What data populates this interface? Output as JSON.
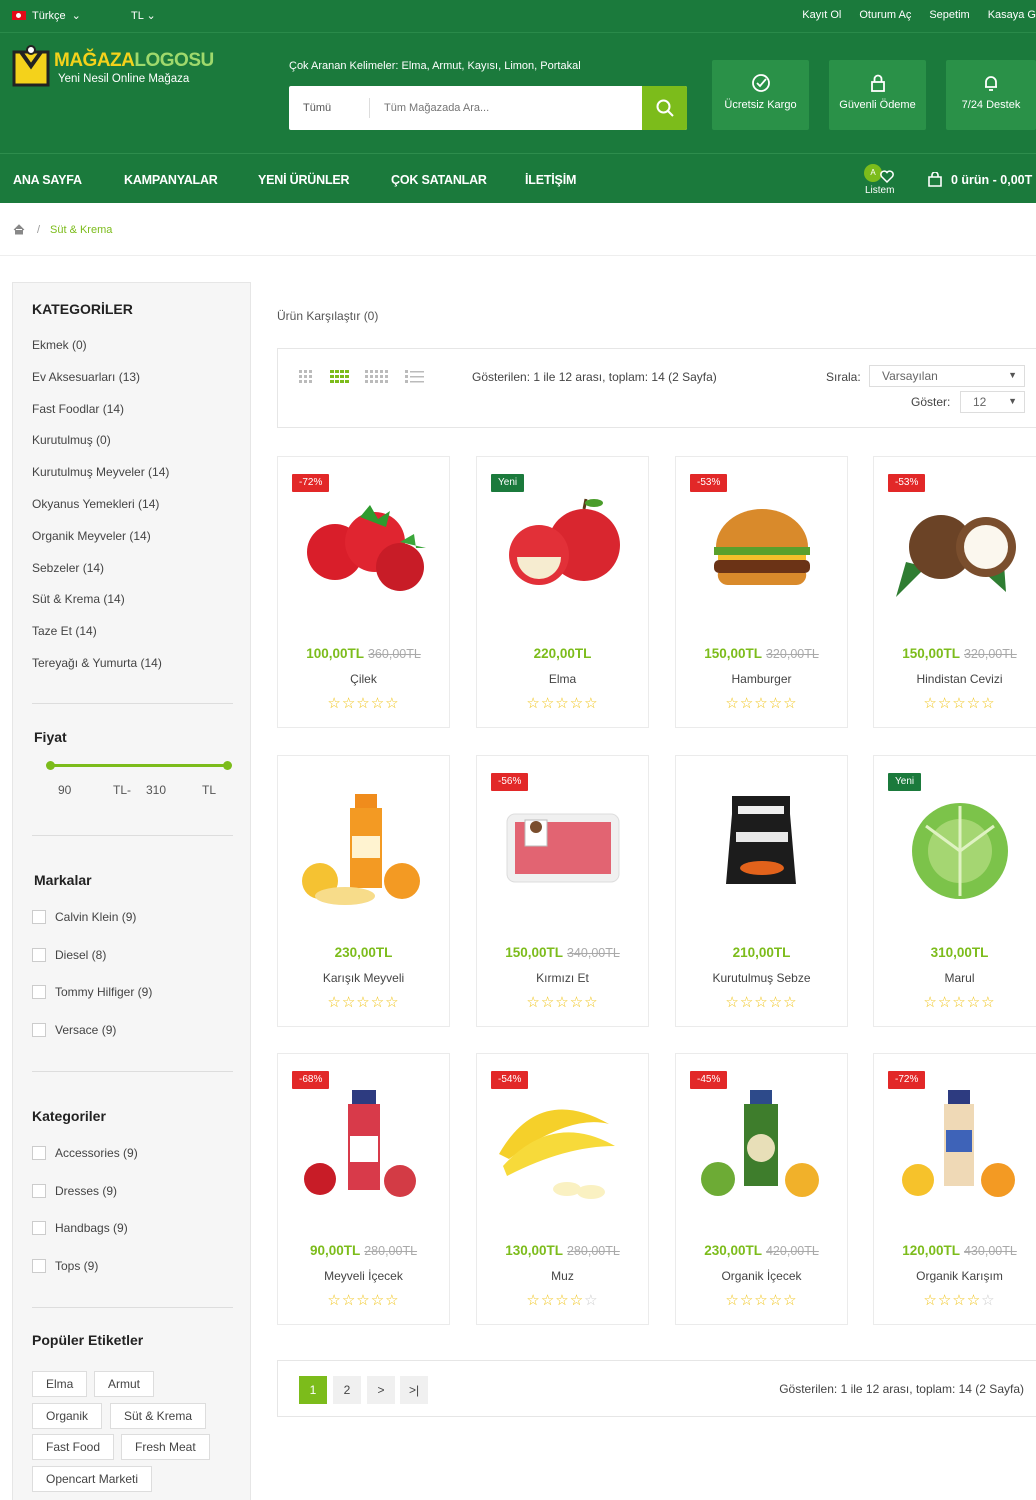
{
  "topbar": {
    "language": "Türkçe",
    "currency": "TL",
    "links": [
      "Kayıt Ol",
      "Oturum Aç",
      "Sepetim",
      "Kasaya G"
    ]
  },
  "logo": {
    "title_a": "MAĞAZA",
    "title_b": "LOGOSU",
    "tagline": "Yeni Nesil Online Mağaza"
  },
  "search": {
    "popular_label": "Çok Aranan Kelimeler:",
    "popular_words": "Elma, Armut, Kayısı, Limon, Portakal",
    "category": "Tümü",
    "placeholder": "Tüm Mağazada Ara..."
  },
  "features": [
    "Ücretsiz Kargo",
    "Güvenli Ödeme",
    "7/24 Destek"
  ],
  "nav": [
    "ANA SAYFA",
    "KAMPANYALAR",
    "YENİ ÜRÜNLER",
    "ÇOK SATANLAR",
    "İLETİŞİM"
  ],
  "wishlist": {
    "badge": "A",
    "label": "Listem"
  },
  "cart": {
    "label": "0 ürün - 0,00T"
  },
  "breadcrumb": {
    "current": "Süt & Krema"
  },
  "sidebar": {
    "categories_title": "KATEGORİLER",
    "categories": [
      "Ekmek (0)",
      "Ev Aksesuarları (13)",
      "Fast Foodlar (14)",
      "Kurutulmuş (0)",
      "Kurutulmuş Meyveler (14)",
      "Okyanus Yemekleri (14)",
      "Organik Meyveler (14)",
      "Sebzeler (14)",
      "Süt & Krema (14)",
      "Taze Et (14)",
      "Tereyağı & Yumurta (14)"
    ],
    "price_title": "Fiyat",
    "price_min": "90",
    "price_unit1": "TL-",
    "price_max": "310",
    "price_unit2": "TL",
    "brands_title": "Markalar",
    "brands": [
      "Calvin Klein (9)",
      "Diesel (8)",
      "Tommy Hilfiger (9)",
      "Versace (9)"
    ],
    "filter_title": "Kategoriler",
    "filters": [
      "Accessories (9)",
      "Dresses (9)",
      "Handbags (9)",
      "Tops (9)"
    ],
    "tags_title": "Popüler Etiketler",
    "tags": [
      "Elma",
      "Armut",
      "Organik",
      "Süt & Krema",
      "Fast Food",
      "Fresh Meat",
      "Opencart Marketi"
    ]
  },
  "compare": "Ürün Karşılaştır (0)",
  "toolbar": {
    "info": "Gösterilen: 1 ile 12 arası, toplam: 14 (2 Sayfa)",
    "sort_label": "Sırala:",
    "sort_value": "Varsayılan",
    "show_label": "Göster:",
    "show_value": "12"
  },
  "products": [
    {
      "name": "Çilek",
      "price": "100,00TL",
      "old": "360,00TL",
      "badge": "-72%",
      "badge_type": "sale",
      "rating": 5
    },
    {
      "name": "Elma",
      "price": "220,00TL",
      "old": "",
      "badge": "Yeni",
      "badge_type": "new",
      "rating": 5
    },
    {
      "name": "Hamburger",
      "price": "150,00TL",
      "old": "320,00TL",
      "badge": "-53%",
      "badge_type": "sale",
      "rating": 5
    },
    {
      "name": "Hindistan Cevizi",
      "price": "150,00TL",
      "old": "320,00TL",
      "badge": "-53%",
      "badge_type": "sale",
      "rating": 5
    },
    {
      "name": "Karışık Meyveli",
      "price": "230,00TL",
      "old": "",
      "badge": "",
      "badge_type": "",
      "rating": 5
    },
    {
      "name": "Kırmızı Et",
      "price": "150,00TL",
      "old": "340,00TL",
      "badge": "-56%",
      "badge_type": "sale",
      "rating": 5
    },
    {
      "name": "Kurutulmuş Sebze",
      "price": "210,00TL",
      "old": "",
      "badge": "",
      "badge_type": "",
      "rating": 5
    },
    {
      "name": "Marul",
      "price": "310,00TL",
      "old": "",
      "badge": "Yeni",
      "badge_type": "new",
      "rating": 5
    },
    {
      "name": "Meyveli İçecek",
      "price": "90,00TL",
      "old": "280,00TL",
      "badge": "-68%",
      "badge_type": "sale",
      "rating": 5
    },
    {
      "name": "Muz",
      "price": "130,00TL",
      "old": "280,00TL",
      "badge": "-54%",
      "badge_type": "sale",
      "rating": 4
    },
    {
      "name": "Organik İçecek",
      "price": "230,00TL",
      "old": "420,00TL",
      "badge": "-45%",
      "badge_type": "sale",
      "rating": 5
    },
    {
      "name": "Organik Karışım",
      "price": "120,00TL",
      "old": "430,00TL",
      "badge": "-72%",
      "badge_type": "sale",
      "rating": 4
    }
  ],
  "pagination": {
    "pages": [
      "1",
      "2",
      ">",
      ">|"
    ],
    "info": "Gösterilen: 1 ile 12 arası, toplam: 14 (2 Sayfa)"
  },
  "colors": {
    "brand_green": "#1b7a3c",
    "accent": "#7cbc1b",
    "sale": "#e22828",
    "star": "#f0c419"
  }
}
